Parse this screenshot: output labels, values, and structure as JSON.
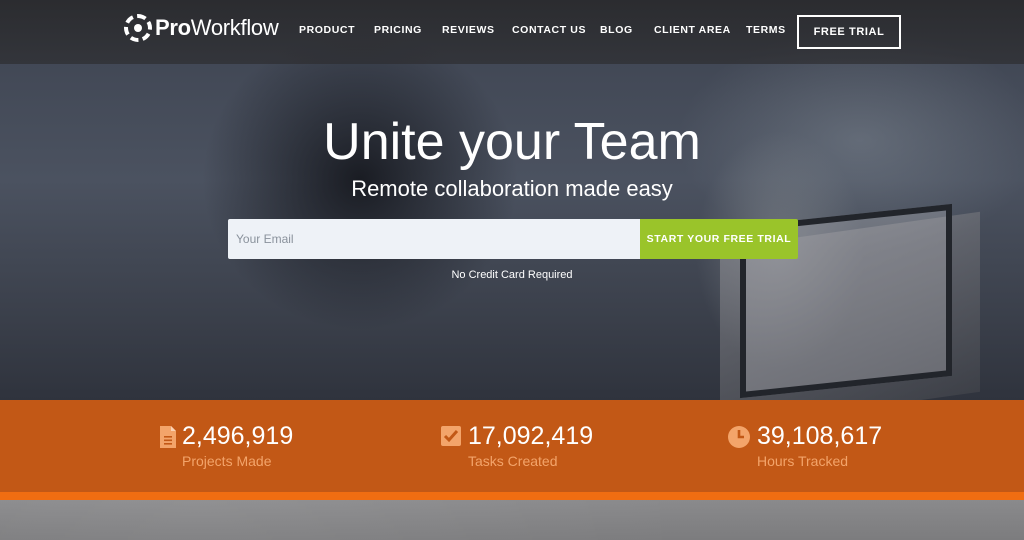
{
  "brand": {
    "pro": "Pro",
    "rest": "Workflow"
  },
  "nav": {
    "product": "PRODUCT",
    "pricing": "PRICING",
    "reviews": "REVIEWS",
    "contact": "CONTACT US",
    "blog": "BLOG",
    "client": "CLIENT AREA",
    "terms": "TERMS"
  },
  "header": {
    "trial_label": "FREE TRIAL"
  },
  "hero": {
    "headline": "Unite your Team",
    "subline": "Remote collaboration made easy",
    "email_placeholder": "Your Email",
    "email_value": "",
    "start_label": "START YOUR FREE TRIAL",
    "note": "No Credit Card Required"
  },
  "stats": [
    {
      "icon": "document-icon",
      "value": "2,496,919",
      "label": "Projects Made"
    },
    {
      "icon": "checkbox-icon",
      "value": "17,092,419",
      "label": "Tasks Created"
    },
    {
      "icon": "clock-icon",
      "value": "39,108,617",
      "label": "Hours Tracked"
    }
  ],
  "colors": {
    "accent_green": "#9ac42a",
    "stats_orange": "#c25816",
    "stripe_orange": "#f06d12",
    "stat_label": "#f3a46a"
  }
}
